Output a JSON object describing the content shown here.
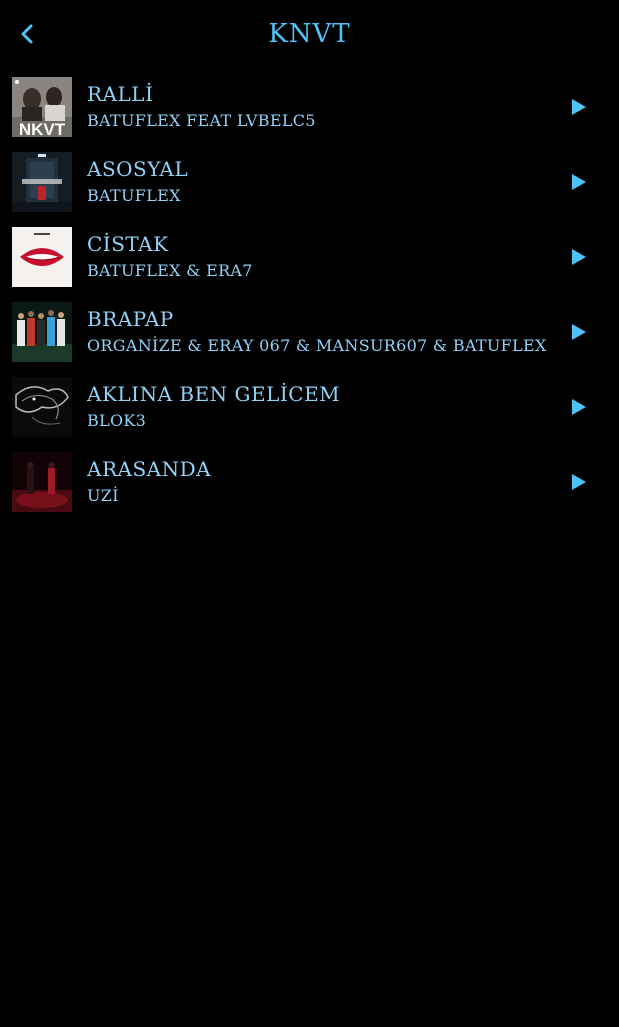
{
  "header": {
    "title": "KNVT",
    "back_icon": "chevron-left-icon",
    "accent_color": "#4fc3f7"
  },
  "tracks": [
    {
      "title": "RALLİ",
      "artist": "BATUFLEX FEAT LVBELC5",
      "cover_text": "NKVT",
      "play_icon": "play-icon"
    },
    {
      "title": "ASOSYAL",
      "artist": "BATUFLEX",
      "play_icon": "play-icon"
    },
    {
      "title": "CİSTAK",
      "artist": "BATUFLEX & ERA7",
      "play_icon": "play-icon"
    },
    {
      "title": "BRAPAP",
      "artist": "ORGANİZE & ERAY 067 & MANSUR607 & BATUFLEX",
      "play_icon": "play-icon"
    },
    {
      "title": "AKLINA BEN GELİCEM",
      "artist": "BLOK3",
      "play_icon": "play-icon"
    },
    {
      "title": "ARASANDA",
      "artist": "UZİ",
      "play_icon": "play-icon"
    }
  ]
}
